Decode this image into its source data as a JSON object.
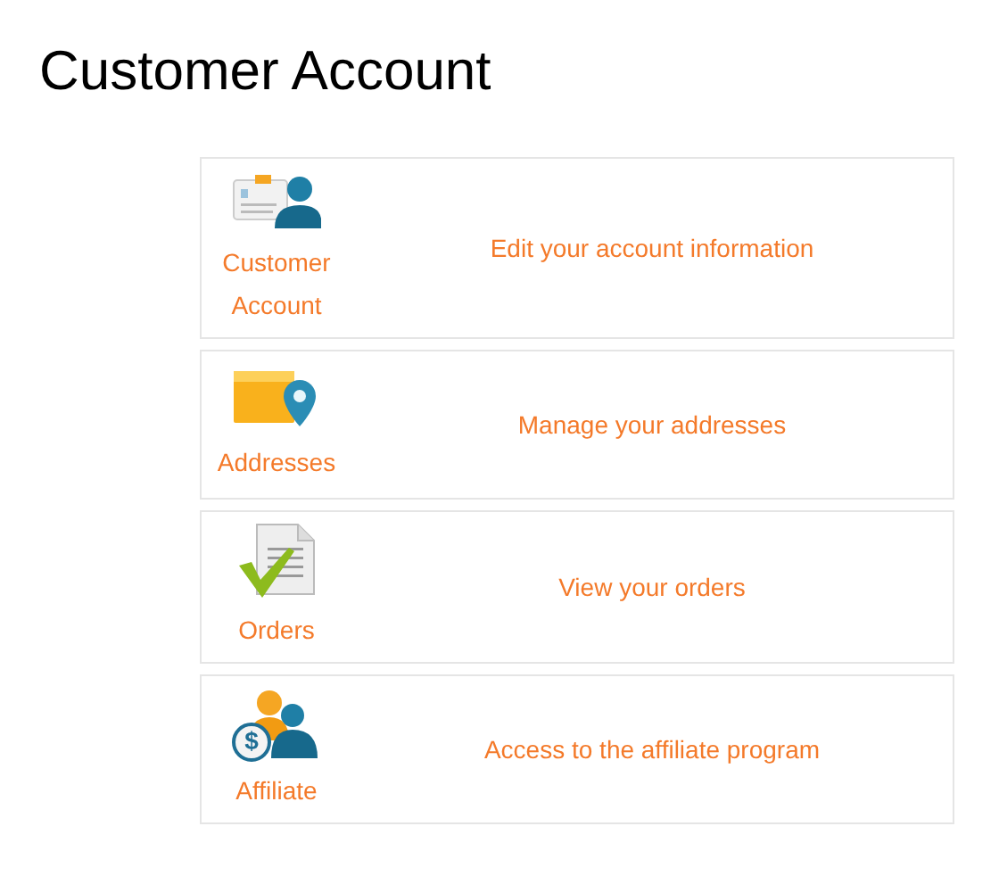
{
  "page_title": "Customer Account",
  "items": [
    {
      "kind": "account",
      "label": "Customer Account",
      "description": "Edit your account information"
    },
    {
      "kind": "addresses",
      "label": "Addresses",
      "description": "Manage your addresses"
    },
    {
      "kind": "orders",
      "label": "Orders",
      "description": "View your orders"
    },
    {
      "kind": "affiliate",
      "label": "Affiliate",
      "description": "Access to the affiliate program",
      "icon_glyph": "$"
    }
  ]
}
